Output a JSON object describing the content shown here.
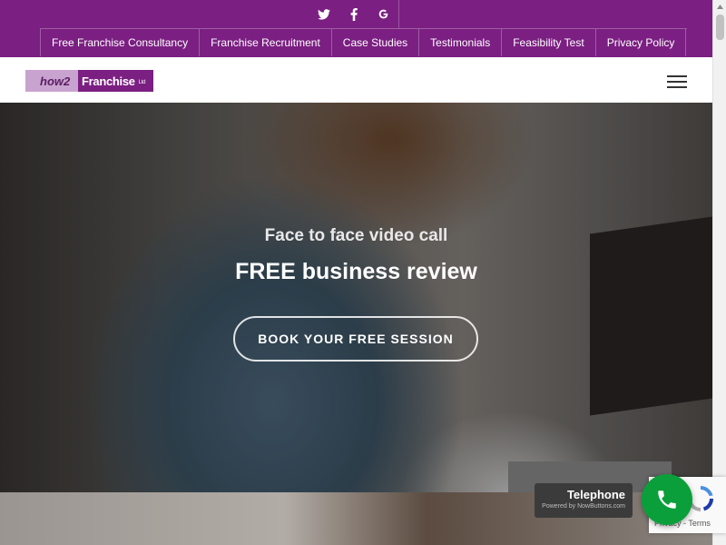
{
  "social": [
    {
      "icon": "twitter-icon",
      "glyph": "t"
    },
    {
      "icon": "facebook-icon",
      "glyph": "f"
    },
    {
      "icon": "google-icon",
      "glyph": "G"
    }
  ],
  "nav": {
    "items": [
      {
        "label": "Free Franchise Consultancy"
      },
      {
        "label": "Franchise Recruitment"
      },
      {
        "label": "Case Studies"
      },
      {
        "label": "Testimonials"
      },
      {
        "label": "Feasibility Test"
      },
      {
        "label": "Privacy Policy"
      }
    ]
  },
  "logo": {
    "part1": "how2",
    "part2": "Franchise",
    "part3": "Ltd"
  },
  "hero": {
    "subtitle": "Face to face video call",
    "title": "FREE business review",
    "button": "BOOK YOUR FREE SESSION"
  },
  "telephone": {
    "label": "Telephone",
    "powered": "Powered by NowButtons.com"
  },
  "recaptcha": {
    "terms": "Privacy - Terms"
  },
  "colors": {
    "brand_purple": "#7b1f82",
    "call_green": "#0a9f3a"
  }
}
